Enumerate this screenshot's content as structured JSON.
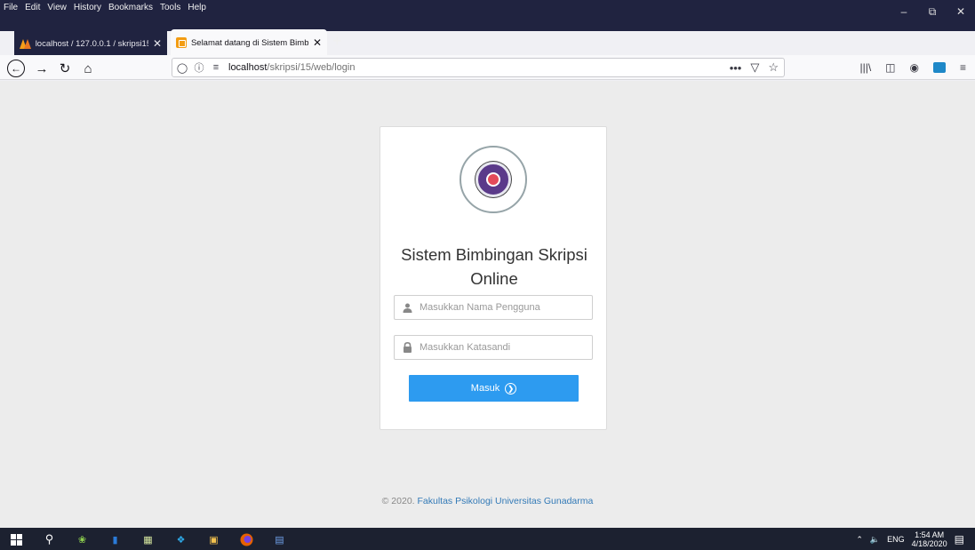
{
  "menubar": [
    "File",
    "Edit",
    "View",
    "History",
    "Bookmarks",
    "Tools",
    "Help"
  ],
  "tabs": [
    {
      "title": "localhost / 127.0.0.1 / skripsi15",
      "active": false
    },
    {
      "title": "Selamat datang di Sistem Bimb",
      "active": true
    }
  ],
  "urlbar": {
    "host": "localhost",
    "path": "/skripsi/15/web/login",
    "overflow": "•••"
  },
  "page": {
    "title": "Sistem Bimbingan Skripsi Online",
    "username_placeholder": "Masukkan Nama Pengguna",
    "password_placeholder": "Masukkan Katasandi",
    "submit_label": "Masuk",
    "footer_prefix": "© 2020.",
    "footer_link": "Fakultas Psikologi Universitas Gunadarma"
  },
  "taskbar": {
    "language": "ENG",
    "time": "1:54 AM",
    "date": "4/18/2020"
  },
  "colors": {
    "accent": "#2d9bf0",
    "chrome_dark": "#202340",
    "page_bg": "#ececec",
    "link": "#337ab7"
  },
  "icons": [
    "back-icon",
    "forward-icon",
    "reload-icon",
    "home-icon",
    "shield-icon",
    "info-icon",
    "permissions-icon",
    "pocket-icon",
    "star-icon",
    "library-icon",
    "sidebar-icon",
    "account-icon",
    "extension-icon",
    "menu-icon",
    "user-icon",
    "lock-icon",
    "arrow-circle-icon"
  ]
}
